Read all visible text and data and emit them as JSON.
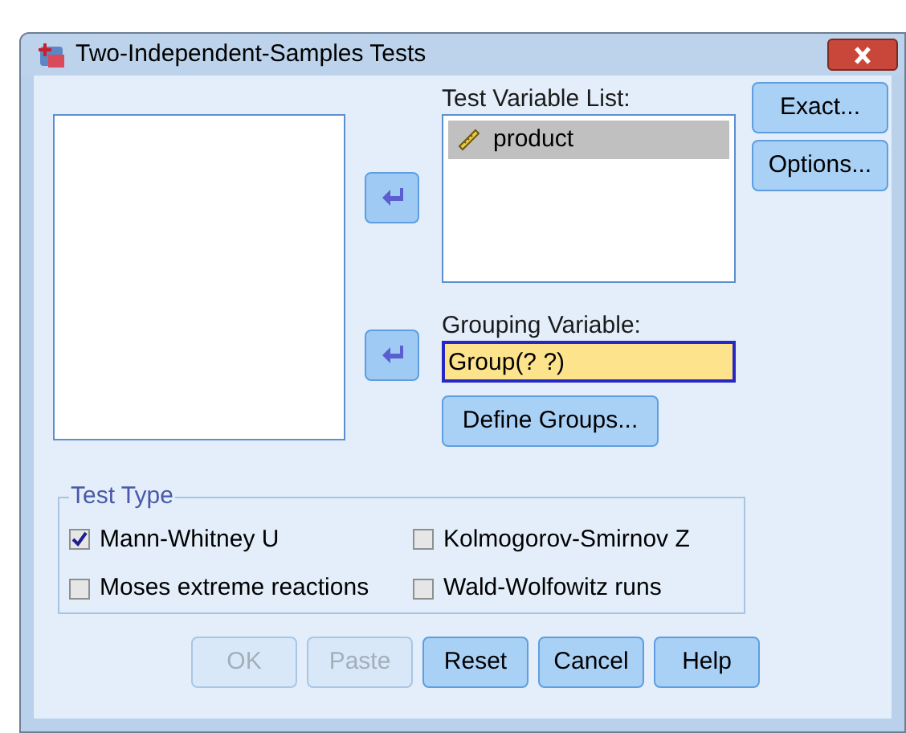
{
  "window": {
    "title": "Two-Independent-Samples Tests"
  },
  "test_variable_list": {
    "label": "Test Variable List:",
    "items": [
      {
        "name": "product",
        "selected": true
      }
    ]
  },
  "grouping_variable": {
    "label": "Grouping Variable:",
    "value": "Group(? ?)"
  },
  "side_buttons": [
    {
      "label": "Exact..."
    },
    {
      "label": "Options..."
    }
  ],
  "define_groups_button": {
    "label": "Define Groups..."
  },
  "test_type": {
    "title": "Test Type",
    "options": [
      {
        "label": "Mann-Whitney U",
        "checked": true
      },
      {
        "label": "Kolmogorov-Smirnov Z",
        "checked": false
      },
      {
        "label": "Moses extreme reactions",
        "checked": false
      },
      {
        "label": "Wald-Wolfowitz runs",
        "checked": false
      }
    ]
  },
  "buttons": [
    {
      "label": "OK",
      "disabled": true
    },
    {
      "label": "Paste",
      "disabled": true
    },
    {
      "label": "Reset",
      "disabled": false
    },
    {
      "label": "Cancel",
      "disabled": false
    },
    {
      "label": "Help",
      "disabled": false
    }
  ]
}
